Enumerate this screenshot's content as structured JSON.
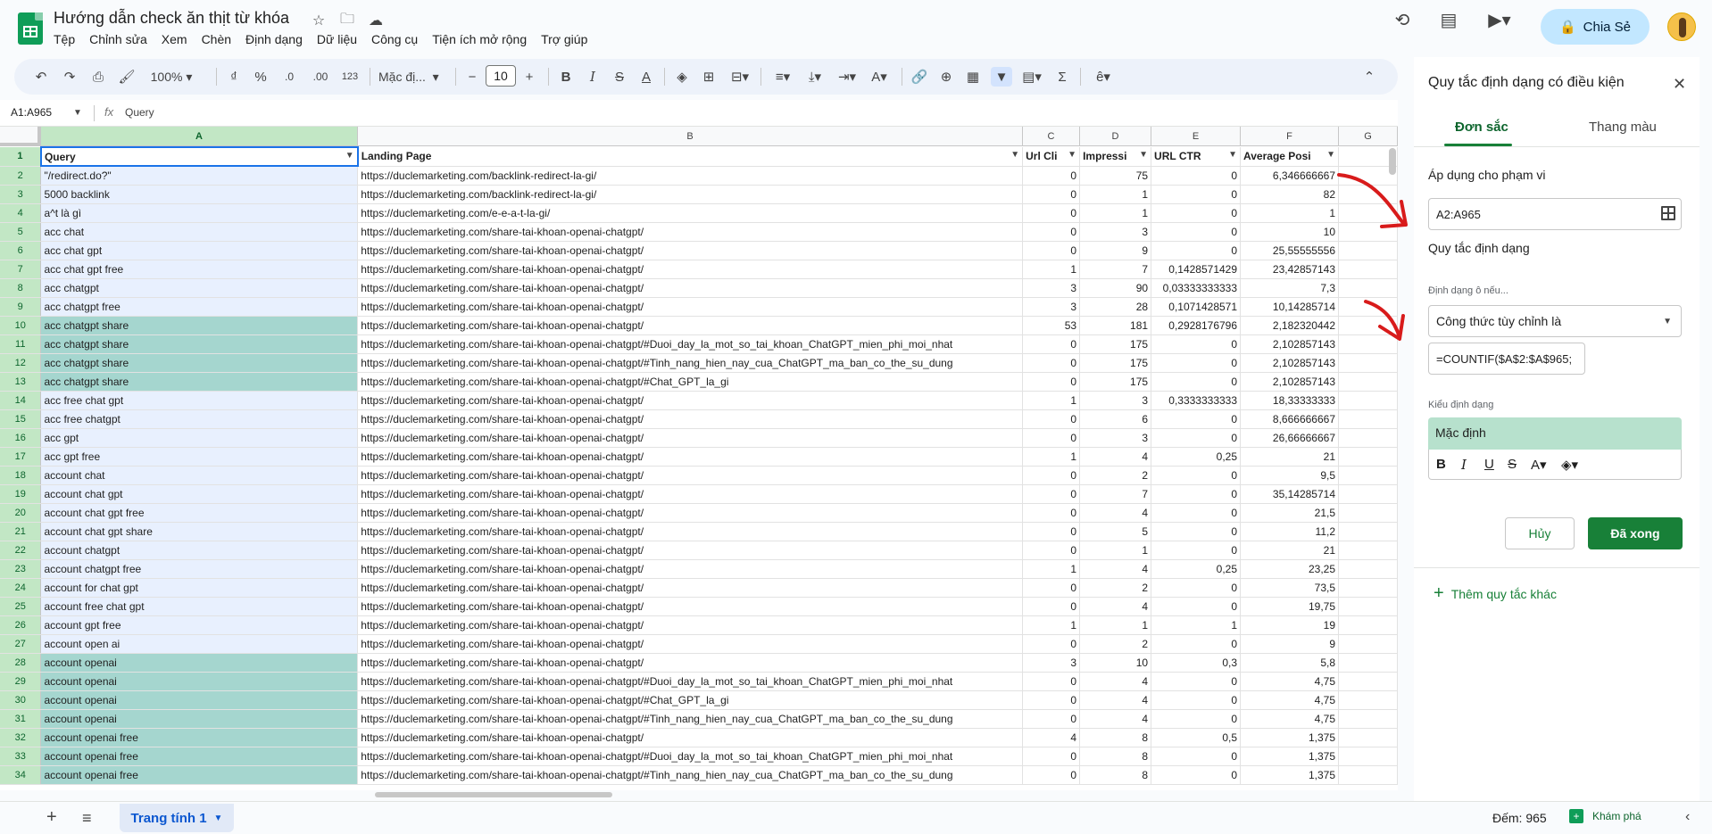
{
  "doc": {
    "title": "Hướng dẫn check ăn thịt từ khóa",
    "menu": [
      "Tệp",
      "Chỉnh sửa",
      "Xem",
      "Chèn",
      "Định dạng",
      "Dữ liệu",
      "Công cụ",
      "Tiện ích mở rộng",
      "Trợ giúp"
    ],
    "share_label": "Chia Sẻ"
  },
  "toolbar": {
    "zoom": "100%",
    "currency": "₫",
    "percent": "%",
    "dec_minus": ".0",
    "dec_plus": ".00",
    "format_123": "123",
    "font": "Mặc đị...",
    "font_size": "10"
  },
  "formula_bar": {
    "name_box": "A1:A965",
    "content": "Query"
  },
  "columns": [
    "A",
    "B",
    "C",
    "D",
    "E",
    "F",
    "G"
  ],
  "headers": [
    "Query",
    "Landing Page",
    "Url Cli",
    "Impressi",
    "URL CTR",
    "Average Posi"
  ],
  "rows": [
    {
      "n": "2",
      "q": "\"/redirect.do?\"",
      "url": "https://duclemarketing.com/backlink-redirect-la-gi/",
      "c": "0",
      "d": "75",
      "e": "0",
      "f": "6,346666667",
      "dup": false
    },
    {
      "n": "3",
      "q": "5000 backlink",
      "url": "https://duclemarketing.com/backlink-redirect-la-gi/",
      "c": "0",
      "d": "1",
      "e": "0",
      "f": "82",
      "dup": false
    },
    {
      "n": "4",
      "q": "a^t là gì",
      "url": "https://duclemarketing.com/e-e-a-t-la-gi/",
      "c": "0",
      "d": "1",
      "e": "0",
      "f": "1",
      "dup": false
    },
    {
      "n": "5",
      "q": "acc chat",
      "url": "https://duclemarketing.com/share-tai-khoan-openai-chatgpt/",
      "c": "0",
      "d": "3",
      "e": "0",
      "f": "10",
      "dup": false
    },
    {
      "n": "6",
      "q": "acc chat gpt",
      "url": "https://duclemarketing.com/share-tai-khoan-openai-chatgpt/",
      "c": "0",
      "d": "9",
      "e": "0",
      "f": "25,55555556",
      "dup": false
    },
    {
      "n": "7",
      "q": "acc chat gpt free",
      "url": "https://duclemarketing.com/share-tai-khoan-openai-chatgpt/",
      "c": "1",
      "d": "7",
      "e": "0,1428571429",
      "f": "23,42857143",
      "dup": false
    },
    {
      "n": "8",
      "q": "acc chatgpt",
      "url": "https://duclemarketing.com/share-tai-khoan-openai-chatgpt/",
      "c": "3",
      "d": "90",
      "e": "0,03333333333",
      "f": "7,3",
      "dup": false
    },
    {
      "n": "9",
      "q": "acc chatgpt free",
      "url": "https://duclemarketing.com/share-tai-khoan-openai-chatgpt/",
      "c": "3",
      "d": "28",
      "e": "0,1071428571",
      "f": "10,14285714",
      "dup": false
    },
    {
      "n": "10",
      "q": "acc chatgpt share",
      "url": "https://duclemarketing.com/share-tai-khoan-openai-chatgpt/",
      "c": "53",
      "d": "181",
      "e": "0,2928176796",
      "f": "2,182320442",
      "dup": true
    },
    {
      "n": "11",
      "q": "acc chatgpt share",
      "url": "https://duclemarketing.com/share-tai-khoan-openai-chatgpt/#Duoi_day_la_mot_so_tai_khoan_ChatGPT_mien_phi_moi_nhat",
      "c": "0",
      "d": "175",
      "e": "0",
      "f": "2,102857143",
      "dup": true
    },
    {
      "n": "12",
      "q": "acc chatgpt share",
      "url": "https://duclemarketing.com/share-tai-khoan-openai-chatgpt/#Tinh_nang_hien_nay_cua_ChatGPT_ma_ban_co_the_su_dung",
      "c": "0",
      "d": "175",
      "e": "0",
      "f": "2,102857143",
      "dup": true
    },
    {
      "n": "13",
      "q": "acc chatgpt share",
      "url": "https://duclemarketing.com/share-tai-khoan-openai-chatgpt/#Chat_GPT_la_gi",
      "c": "0",
      "d": "175",
      "e": "0",
      "f": "2,102857143",
      "dup": true
    },
    {
      "n": "14",
      "q": "acc free chat gpt",
      "url": "https://duclemarketing.com/share-tai-khoan-openai-chatgpt/",
      "c": "1",
      "d": "3",
      "e": "0,3333333333",
      "f": "18,33333333",
      "dup": false
    },
    {
      "n": "15",
      "q": "acc free chatgpt",
      "url": "https://duclemarketing.com/share-tai-khoan-openai-chatgpt/",
      "c": "0",
      "d": "6",
      "e": "0",
      "f": "8,666666667",
      "dup": false
    },
    {
      "n": "16",
      "q": "acc gpt",
      "url": "https://duclemarketing.com/share-tai-khoan-openai-chatgpt/",
      "c": "0",
      "d": "3",
      "e": "0",
      "f": "26,66666667",
      "dup": false
    },
    {
      "n": "17",
      "q": "acc gpt free",
      "url": "https://duclemarketing.com/share-tai-khoan-openai-chatgpt/",
      "c": "1",
      "d": "4",
      "e": "0,25",
      "f": "21",
      "dup": false
    },
    {
      "n": "18",
      "q": "account chat",
      "url": "https://duclemarketing.com/share-tai-khoan-openai-chatgpt/",
      "c": "0",
      "d": "2",
      "e": "0",
      "f": "9,5",
      "dup": false
    },
    {
      "n": "19",
      "q": "account chat gpt",
      "url": "https://duclemarketing.com/share-tai-khoan-openai-chatgpt/",
      "c": "0",
      "d": "7",
      "e": "0",
      "f": "35,14285714",
      "dup": false
    },
    {
      "n": "20",
      "q": "account chat gpt free",
      "url": "https://duclemarketing.com/share-tai-khoan-openai-chatgpt/",
      "c": "0",
      "d": "4",
      "e": "0",
      "f": "21,5",
      "dup": false
    },
    {
      "n": "21",
      "q": "account chat gpt share",
      "url": "https://duclemarketing.com/share-tai-khoan-openai-chatgpt/",
      "c": "0",
      "d": "5",
      "e": "0",
      "f": "11,2",
      "dup": false
    },
    {
      "n": "22",
      "q": "account chatgpt",
      "url": "https://duclemarketing.com/share-tai-khoan-openai-chatgpt/",
      "c": "0",
      "d": "1",
      "e": "0",
      "f": "21",
      "dup": false
    },
    {
      "n": "23",
      "q": "account chatgpt free",
      "url": "https://duclemarketing.com/share-tai-khoan-openai-chatgpt/",
      "c": "1",
      "d": "4",
      "e": "0,25",
      "f": "23,25",
      "dup": false
    },
    {
      "n": "24",
      "q": "account for chat gpt",
      "url": "https://duclemarketing.com/share-tai-khoan-openai-chatgpt/",
      "c": "0",
      "d": "2",
      "e": "0",
      "f": "73,5",
      "dup": false
    },
    {
      "n": "25",
      "q": "account free chat gpt",
      "url": "https://duclemarketing.com/share-tai-khoan-openai-chatgpt/",
      "c": "0",
      "d": "4",
      "e": "0",
      "f": "19,75",
      "dup": false
    },
    {
      "n": "26",
      "q": "account gpt free",
      "url": "https://duclemarketing.com/share-tai-khoan-openai-chatgpt/",
      "c": "1",
      "d": "1",
      "e": "1",
      "f": "19",
      "dup": false
    },
    {
      "n": "27",
      "q": "account open ai",
      "url": "https://duclemarketing.com/share-tai-khoan-openai-chatgpt/",
      "c": "0",
      "d": "2",
      "e": "0",
      "f": "9",
      "dup": false
    },
    {
      "n": "28",
      "q": "account openai",
      "url": "https://duclemarketing.com/share-tai-khoan-openai-chatgpt/",
      "c": "3",
      "d": "10",
      "e": "0,3",
      "f": "5,8",
      "dup": true
    },
    {
      "n": "29",
      "q": "account openai",
      "url": "https://duclemarketing.com/share-tai-khoan-openai-chatgpt/#Duoi_day_la_mot_so_tai_khoan_ChatGPT_mien_phi_moi_nhat",
      "c": "0",
      "d": "4",
      "e": "0",
      "f": "4,75",
      "dup": true
    },
    {
      "n": "30",
      "q": "account openai",
      "url": "https://duclemarketing.com/share-tai-khoan-openai-chatgpt/#Chat_GPT_la_gi",
      "c": "0",
      "d": "4",
      "e": "0",
      "f": "4,75",
      "dup": true
    },
    {
      "n": "31",
      "q": "account openai",
      "url": "https://duclemarketing.com/share-tai-khoan-openai-chatgpt/#Tinh_nang_hien_nay_cua_ChatGPT_ma_ban_co_the_su_dung",
      "c": "0",
      "d": "4",
      "e": "0",
      "f": "4,75",
      "dup": true
    },
    {
      "n": "32",
      "q": "account openai free",
      "url": "https://duclemarketing.com/share-tai-khoan-openai-chatgpt/",
      "c": "4",
      "d": "8",
      "e": "0,5",
      "f": "1,375",
      "dup": true
    },
    {
      "n": "33",
      "q": "account openai free",
      "url": "https://duclemarketing.com/share-tai-khoan-openai-chatgpt/#Duoi_day_la_mot_so_tai_khoan_ChatGPT_mien_phi_moi_nhat",
      "c": "0",
      "d": "8",
      "e": "0",
      "f": "1,375",
      "dup": true
    },
    {
      "n": "34",
      "q": "account openai free",
      "url": "https://duclemarketing.com/share-tai-khoan-openai-chatgpt/#Tinh_nang_hien_nay_cua_ChatGPT_ma_ban_co_the_su_dung",
      "c": "0",
      "d": "8",
      "e": "0",
      "f": "1,375",
      "dup": true
    }
  ],
  "panel": {
    "title": "Quy tắc định dạng có điều kiện",
    "tab_single": "Đơn sắc",
    "tab_scale": "Thang màu",
    "apply_label": "Áp dụng cho phạm vi",
    "range": "A2:A965",
    "rules_label": "Quy tắc định dạng",
    "condition_label": "Định dạng ô nếu...",
    "condition": "Công thức tùy chỉnh là",
    "formula": "=COUNTIF($A$2:$A$965;",
    "style_label": "Kiểu định dạng",
    "style_preview": "Mặc định",
    "cancel": "Hủy",
    "done": "Đã xong",
    "add_rule": "Thêm quy tắc khác"
  },
  "bottom": {
    "sheet_tab": "Trang tính 1",
    "count": "Đếm: 965",
    "explore": "Khám phá"
  },
  "colors": {
    "accent_green": "#188038",
    "dup_fill": "#a5d6cf",
    "selection_fill": "#e8f0fe",
    "share_bg": "#c2e7ff"
  }
}
